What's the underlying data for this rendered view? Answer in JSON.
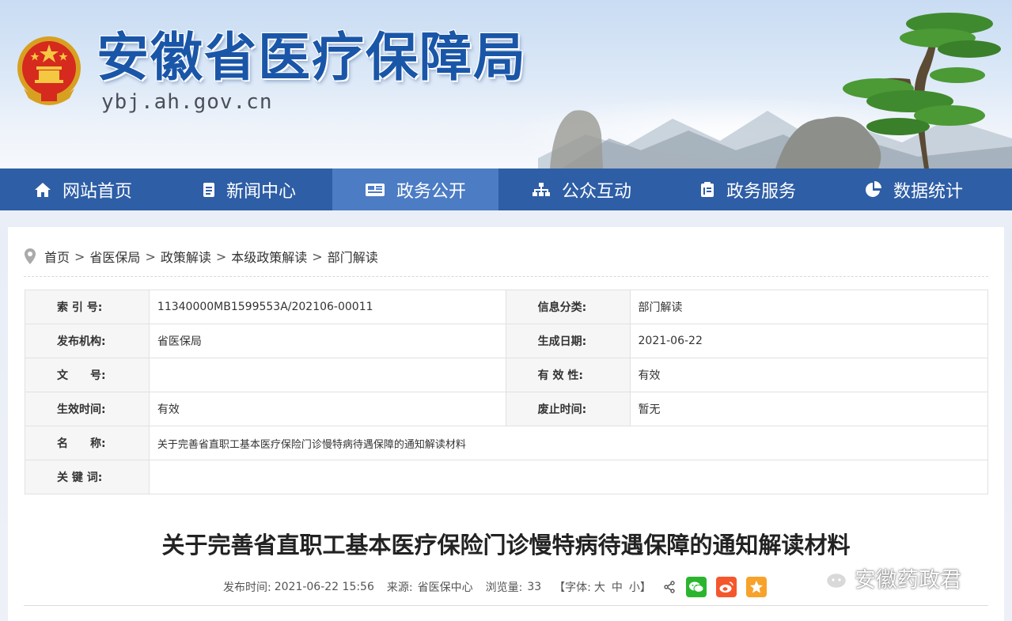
{
  "site": {
    "title": "安徽省医疗保障局",
    "domain": "ybj.ah.gov.cn"
  },
  "nav": {
    "items": [
      {
        "label": "网站首页",
        "icon": "home-icon"
      },
      {
        "label": "新闻中心",
        "icon": "document-icon"
      },
      {
        "label": "政务公开",
        "icon": "newspaper-icon",
        "active": true
      },
      {
        "label": "公众互动",
        "icon": "sitemap-icon"
      },
      {
        "label": "政务服务",
        "icon": "clipboard-icon"
      },
      {
        "label": "数据统计",
        "icon": "pie-chart-icon"
      }
    ],
    "color": "#2e5ea6",
    "active_color": "#4c7cc4"
  },
  "breadcrumb": [
    "首页",
    "省医保局",
    "政策解读",
    "本级政策解读",
    "部门解读"
  ],
  "meta": {
    "index_no_label": "索 引 号:",
    "index_no": "11340000MB1599553A/202106-00011",
    "category_label": "信息分类:",
    "category": "部门解读",
    "publisher_label": "发布机构:",
    "publisher": "省医保局",
    "created_label": "生成日期:",
    "created": "2021-06-22",
    "doc_no_label": "文　　号:",
    "doc_no": "",
    "validity_label": "有 效 性:",
    "validity": "有效",
    "effective_label": "生效时间:",
    "effective": "有效",
    "expiry_label": "废止时间:",
    "expiry": "暂无",
    "name_label": "名　　称:",
    "name": "关于完善省直职工基本医疗保险门诊慢特病待遇保障的通知解读材料",
    "keywords_label": "关 键 词:",
    "keywords": ""
  },
  "article": {
    "title": "关于完善省直职工基本医疗保险门诊慢特病待遇保障的通知解读材料",
    "publish_label": "发布时间:",
    "publish_time": "2021-06-22 15:56",
    "source_label": "来源:",
    "source": "省医保中心",
    "views_label": "浏览量:",
    "views": "33",
    "font_label": "【字体:",
    "font_large": "大",
    "font_medium": "中",
    "font_small": "小】"
  },
  "watermark": "安徽药政君"
}
